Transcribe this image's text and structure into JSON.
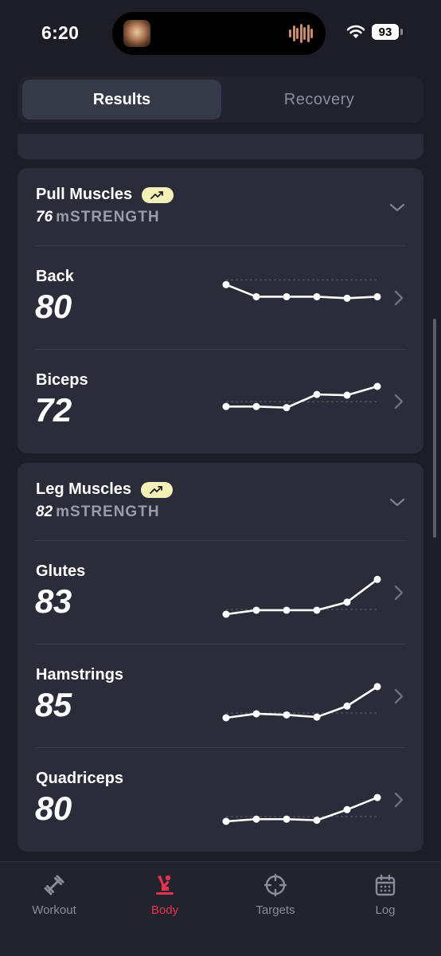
{
  "status_bar": {
    "time": "6:20",
    "battery": "93"
  },
  "segments": {
    "results": "Results",
    "recovery": "Recovery"
  },
  "groups": [
    {
      "title": "Pull Muscles",
      "score": "76",
      "unit": "mSTRENGTH",
      "muscles": [
        {
          "name": "Back",
          "score": "80",
          "trend": [
            0.95,
            0.62,
            0.62,
            0.62,
            0.58,
            0.62
          ]
        },
        {
          "name": "Biceps",
          "score": "72",
          "trend": [
            0.45,
            0.45,
            0.42,
            0.78,
            0.76,
            1.0
          ]
        }
      ]
    },
    {
      "title": "Leg Muscles",
      "score": "82",
      "unit": "mSTRENGTH",
      "muscles": [
        {
          "name": "Glutes",
          "score": "83",
          "trend": [
            0.0,
            0.11,
            0.11,
            0.11,
            0.33,
            0.95
          ]
        },
        {
          "name": "Hamstrings",
          "score": "85",
          "trend": [
            0.0,
            0.11,
            0.08,
            0.02,
            0.32,
            0.85
          ]
        },
        {
          "name": "Quadriceps",
          "score": "80",
          "trend": [
            0.0,
            0.06,
            0.06,
            0.03,
            0.32,
            0.65
          ]
        }
      ]
    }
  ],
  "tabs": [
    {
      "label": "Workout",
      "icon": "dumbbell-icon"
    },
    {
      "label": "Body",
      "icon": "body-icon",
      "active": true
    },
    {
      "label": "Targets",
      "icon": "crosshair-icon"
    },
    {
      "label": "Log",
      "icon": "calendar-icon"
    }
  ],
  "colors": {
    "accent": "#e2324f",
    "badge": "#f4f1b8",
    "card": "#2b2c39",
    "background": "#1d1d28"
  }
}
